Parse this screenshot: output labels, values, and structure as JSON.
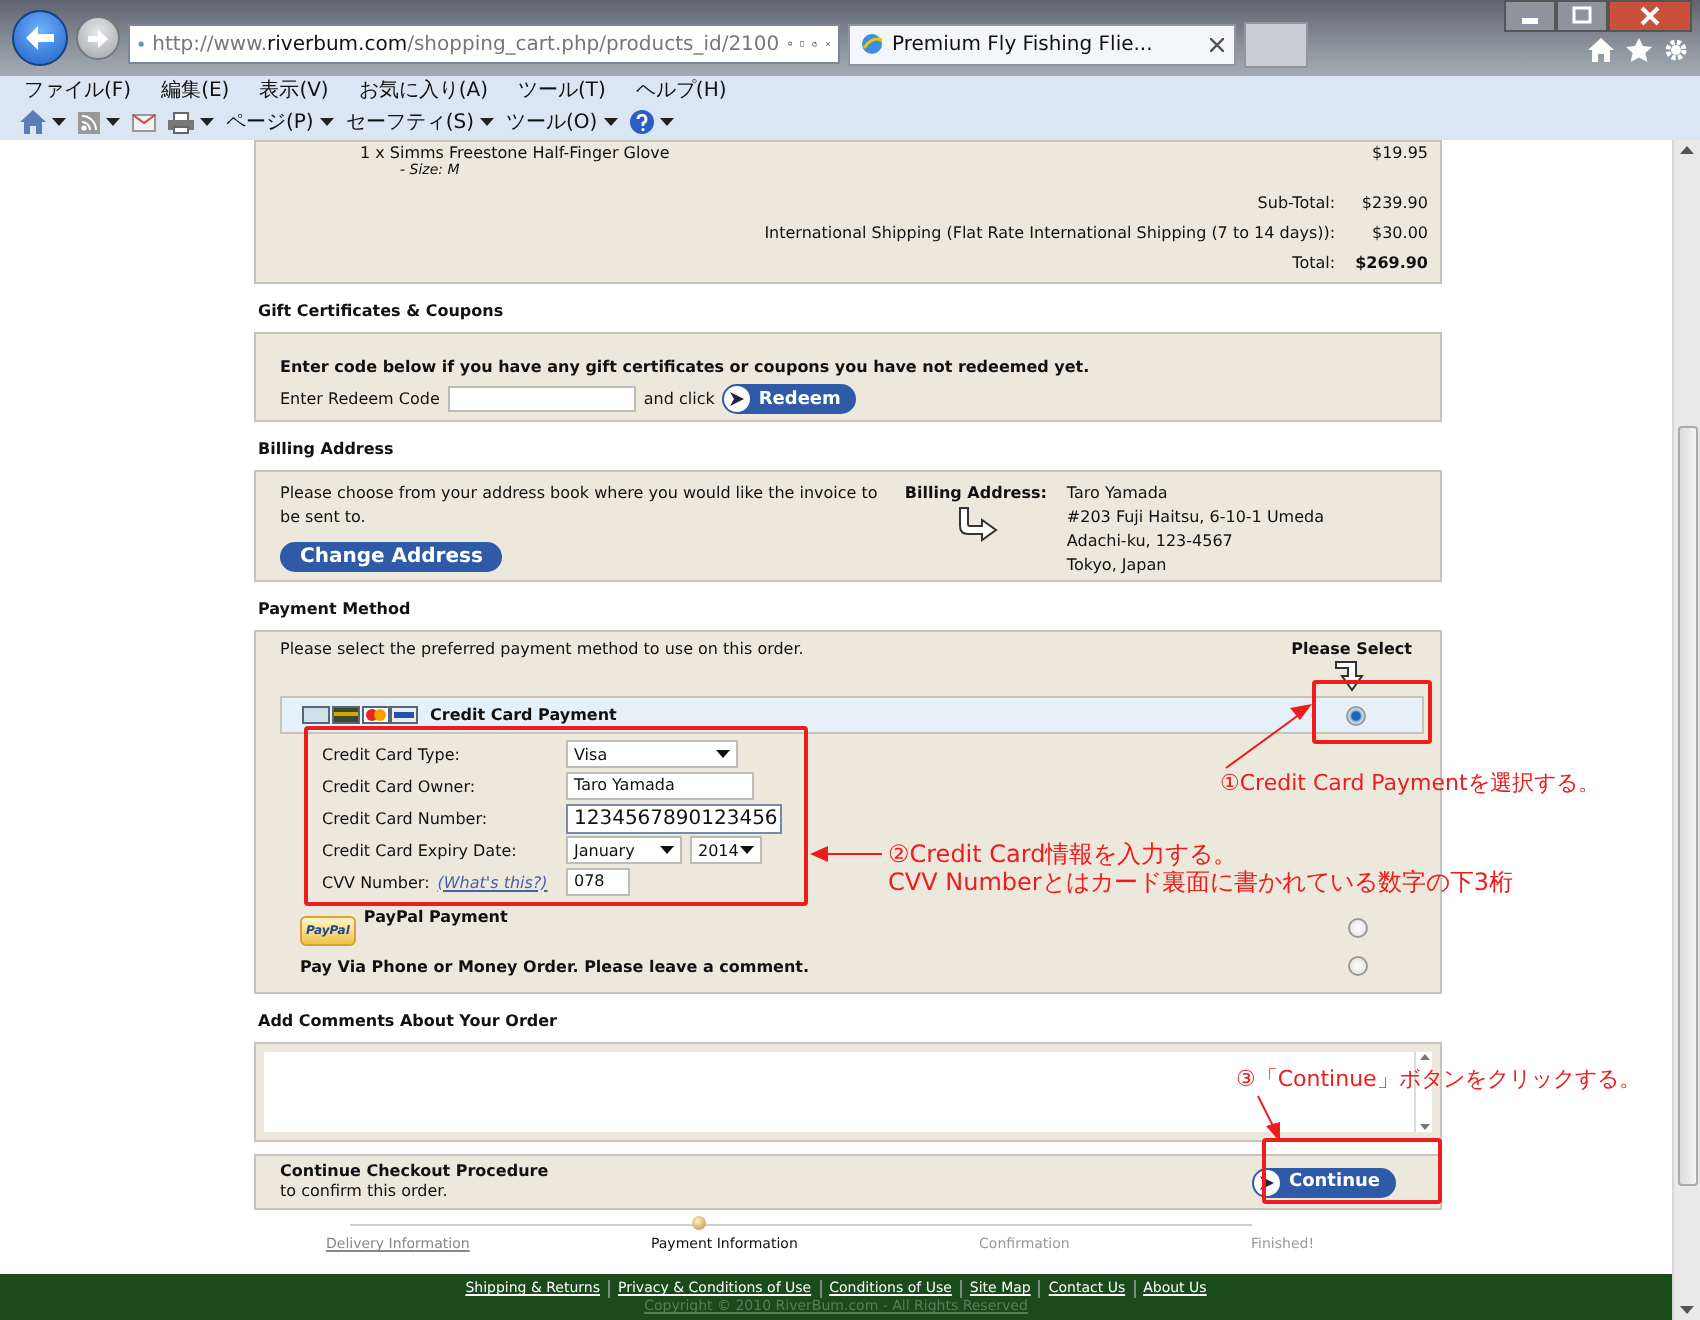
{
  "browser": {
    "address": [
      "http://www.",
      "riverbum.com",
      "/shopping_cart.php/products_id/2100"
    ],
    "tab": "Premium Fly Fishing Flie...",
    "menu": [
      "ファイル(F)",
      "編集(E)",
      "表示(V)",
      "お気に入り(A)",
      "ツール(T)",
      "ヘルプ(H)"
    ],
    "commands": [
      "ページ(P)",
      "セーフティ(S)",
      "ツール(O)"
    ]
  },
  "order": {
    "item": "1 x Simms Freestone Half-Finger Glove",
    "item_price": "$19.95",
    "attribute": "- Size: M",
    "totals": [
      {
        "label": "Sub-Total:",
        "value": "$239.90",
        "bold": false
      },
      {
        "label": "International Shipping (Flat Rate International Shipping (7 to 14 days)):",
        "value": "$30.00",
        "bold": false
      },
      {
        "label": "Total:",
        "value": "$269.90",
        "bold": true
      }
    ]
  },
  "gift": {
    "title": "Gift Certificates & Coupons",
    "intro": "Enter code below if you have any gift certificates or coupons you have not redeemed yet.",
    "code_label": "Enter Redeem Code",
    "and_click": "and click",
    "button": "Redeem"
  },
  "billing": {
    "title": "Billing Address",
    "text": "Please choose from your address book where you would like the invoice to be sent to.",
    "button": "Change Address",
    "label": "Billing Address:",
    "address": [
      "Taro Yamada",
      "#203 Fuji Haitsu, 6-10-1 Umeda",
      "Adachi-ku, 123-4567",
      "Tokyo, Japan"
    ]
  },
  "payment": {
    "title": "Payment Method",
    "intro": "Please select the preferred payment method to use on this order.",
    "please_select": "Please Select",
    "methods": [
      {
        "kind": "card",
        "label": "Credit Card Payment",
        "selected": true
      },
      {
        "kind": "paypal",
        "label": "PayPal Payment",
        "badge": "PayPal",
        "selected": false
      },
      {
        "kind": "plain",
        "label": "Pay Via Phone or Money Order. Please leave a comment.",
        "selected": false
      }
    ],
    "fields": [
      {
        "kind": "select",
        "label": "Credit Card Type:",
        "values": [
          "Visa"
        ]
      },
      {
        "kind": "input",
        "label": "Credit Card Owner:",
        "values": [
          "Taro Yamada"
        ]
      },
      {
        "kind": "input_large",
        "label": "Credit Card Number:",
        "values": [
          "1234567890123456"
        ]
      },
      {
        "kind": "select",
        "label": "Credit Card Expiry Date:",
        "values": [
          "January",
          "2014"
        ]
      },
      {
        "kind": "input_small",
        "label": "CVV Number:",
        "link": "(What's this?)",
        "values": [
          "078"
        ]
      }
    ]
  },
  "comments": {
    "title": "Add Comments About Your Order"
  },
  "continue": {
    "title": "Continue Checkout Procedure",
    "text": "to confirm this order.",
    "button": "Continue"
  },
  "progress": [
    {
      "label": "Delivery Information",
      "done": true,
      "selected": false
    },
    {
      "label": "Payment Information",
      "done": false,
      "selected": true
    },
    {
      "label": "Confirmation",
      "done": false,
      "selected": false
    },
    {
      "label": "Finished!",
      "done": false,
      "selected": false
    }
  ],
  "footer": {
    "links": [
      "Shipping & Returns",
      "Privacy & Conditions of Use",
      "Conditions of Use",
      "Site Map",
      "Contact Us",
      "About Us"
    ],
    "copyright": "Copyright © 2010 RiverBum.com - All Rights Reserved"
  },
  "annotations": [
    {
      "lines": [
        "①Credit Card Paymentを選択する。"
      ]
    },
    {
      "lines": [
        "②Credit Card情報を入力する。",
        "CVV Numberとはカード裏面に書かれている数字の下3桁"
      ]
    },
    {
      "lines": [
        "③「Continue」ボタンをクリックする。"
      ]
    }
  ]
}
